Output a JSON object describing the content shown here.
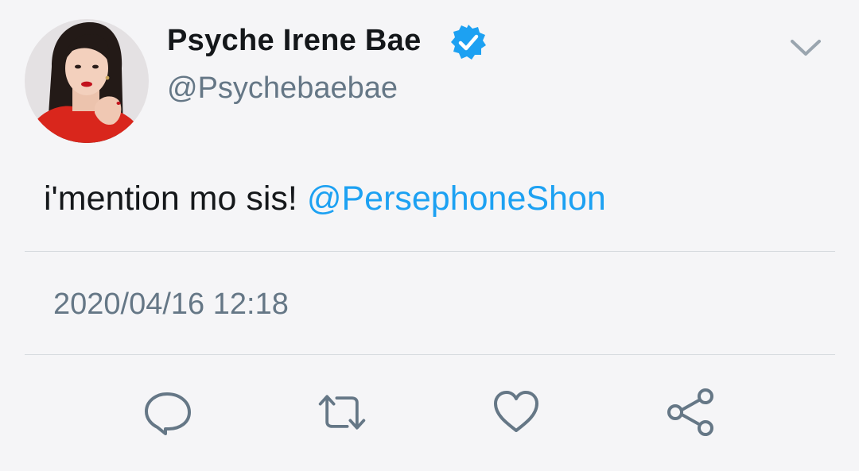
{
  "author": {
    "display_name": "Psyche Irene Bae",
    "handle": "@Psychebaebae",
    "verified": true,
    "avatar_icon": "profile-photo"
  },
  "tweet": {
    "text": "i'mention mo sis! ",
    "mention": "@PersephoneShon",
    "timestamp": "2020/04/16 12:18"
  },
  "actions": {
    "reply_icon": "speech-bubble-icon",
    "retweet_icon": "retweet-arrows-icon",
    "like_icon": "heart-icon",
    "share_icon": "share-nodes-icon",
    "menu_icon": "chevron-down-icon"
  },
  "colors": {
    "background": "#f5f5f7",
    "accent": "#1da1f2",
    "text_primary": "#14171a",
    "text_secondary": "#657786",
    "divider": "#d6dade"
  }
}
